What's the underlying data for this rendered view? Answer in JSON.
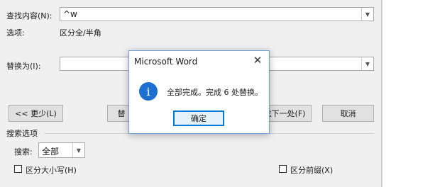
{
  "find": {
    "label": "查找内容(N):",
    "value": "^w",
    "options_label": "选项:",
    "options_value": "区分全/半角"
  },
  "replace": {
    "label": "替换为(I):",
    "value": ""
  },
  "buttons": {
    "less": "<< 更少(L)",
    "replace_partial": "替",
    "find_next": "找下一处(F)",
    "cancel": "取消"
  },
  "search_options": {
    "section_label": "搜索选项",
    "search_label": "搜索:",
    "search_value": "全部",
    "match_case": "区分大小写(H)",
    "match_prefix": "区分前缀(X)"
  },
  "dialog": {
    "title": "Microsoft Word",
    "icon": "info-icon",
    "icon_glyph": "i",
    "message": "全部完成。完成 6 处替换。",
    "ok": "确定"
  }
}
